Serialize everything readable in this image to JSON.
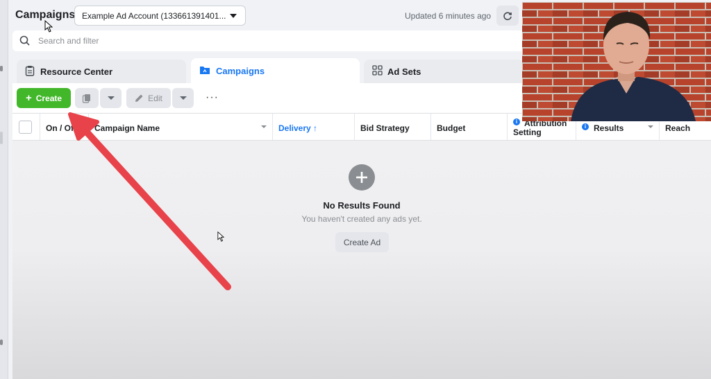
{
  "header": {
    "title": "Campaigns",
    "account_selector": "Example Ad Account (133661391401...",
    "updated_text": "Updated 6 minutes ago"
  },
  "search": {
    "placeholder": "Search and filter"
  },
  "tabs": [
    {
      "label": "Resource Center",
      "icon": "clipboard-icon"
    },
    {
      "label": "Campaigns",
      "icon": "folder-icon",
      "active": true
    },
    {
      "label": "Ad Sets",
      "icon": "grid-icon"
    }
  ],
  "toolbar": {
    "create_label": "Create",
    "edit_label": "Edit",
    "more_label": "···"
  },
  "table": {
    "columns": [
      "On / Off",
      "Campaign Name",
      "Delivery ↑",
      "Bid Strategy",
      "Budget",
      "Attribution Setting",
      "Results",
      "Reach"
    ]
  },
  "empty_state": {
    "title": "No Results Found",
    "subtitle": "You haven't created any ads yet.",
    "button_label": "Create Ad"
  },
  "colors": {
    "create_green": "#42b72a",
    "active_blue": "#1877f2",
    "arrow_red": "#e8424a"
  }
}
